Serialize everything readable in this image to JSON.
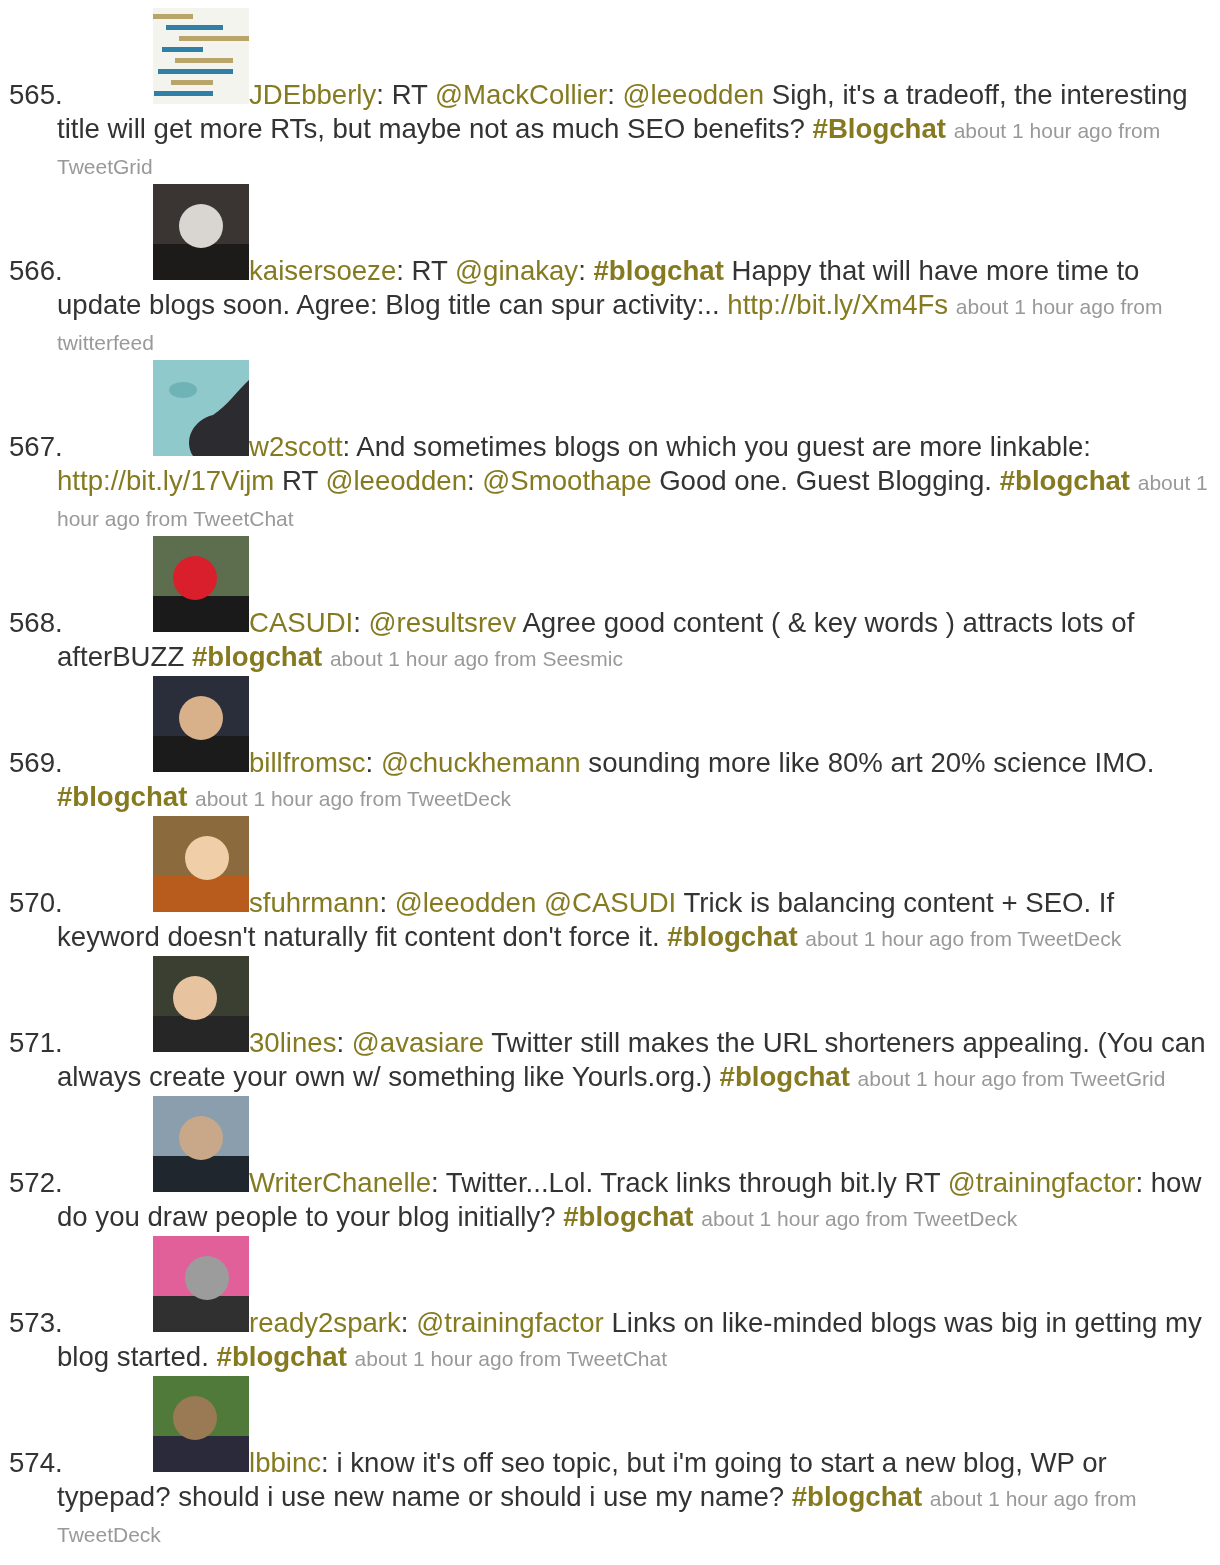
{
  "tweets": [
    {
      "number": "565.",
      "avatar": {
        "kind": "picture"
      },
      "parts": [
        {
          "kind": "user",
          "text": "JDEbberly"
        },
        {
          "kind": "text",
          "text": ": RT "
        },
        {
          "kind": "mention",
          "text": "@MackCollier"
        },
        {
          "kind": "text",
          "text": ": "
        },
        {
          "kind": "mention",
          "text": "@leeodden"
        },
        {
          "kind": "text",
          "text": " Sigh, it's a tradeoff, the interesting title will get more RTs, but maybe not as much SEO benefits? "
        },
        {
          "kind": "hashtag",
          "text": "#Blogchat"
        }
      ],
      "meta": "about 1 hour ago from TweetGrid"
    },
    {
      "number": "566.",
      "avatar": {
        "kind": "picture"
      },
      "parts": [
        {
          "kind": "user",
          "text": "kaisersoeze"
        },
        {
          "kind": "text",
          "text": ": RT "
        },
        {
          "kind": "mention",
          "text": "@ginakay"
        },
        {
          "kind": "text",
          "text": ": "
        },
        {
          "kind": "hashtag",
          "text": "#blogchat"
        },
        {
          "kind": "text",
          "text": " Happy that will have more time to update blogs soon. Agree: Blog title can spur activity:.. "
        },
        {
          "kind": "url",
          "text": "http://bit.ly/Xm4Fs"
        }
      ],
      "meta": "about 1 hour ago from twitterfeed"
    },
    {
      "number": "567.",
      "avatar": {
        "kind": "picture"
      },
      "parts": [
        {
          "kind": "user",
          "text": "w2scott"
        },
        {
          "kind": "text",
          "text": ": And sometimes blogs on which you guest are more linkable: "
        },
        {
          "kind": "url",
          "text": "http://bit.ly/17Vijm"
        },
        {
          "kind": "text",
          "text": " RT "
        },
        {
          "kind": "mention",
          "text": "@leeodden"
        },
        {
          "kind": "text",
          "text": ": "
        },
        {
          "kind": "mention",
          "text": "@Smoothape"
        },
        {
          "kind": "text",
          "text": " Good one. Guest Blogging. "
        },
        {
          "kind": "hashtag",
          "text": "#blogchat"
        }
      ],
      "meta": "about 1 hour ago from TweetChat"
    },
    {
      "number": "568.",
      "avatar": {
        "kind": "picture"
      },
      "parts": [
        {
          "kind": "user",
          "text": "CASUDI"
        },
        {
          "kind": "text",
          "text": ": "
        },
        {
          "kind": "mention",
          "text": "@resultsrev"
        },
        {
          "kind": "text",
          "text": " Agree good content ( & key words ) attracts lots of afterBUZZ "
        },
        {
          "kind": "hashtag",
          "text": "#blogchat"
        }
      ],
      "meta": "about 1 hour ago from Seesmic"
    },
    {
      "number": "569.",
      "avatar": {
        "kind": "picture"
      },
      "parts": [
        {
          "kind": "user",
          "text": "billfromsc"
        },
        {
          "kind": "text",
          "text": ": "
        },
        {
          "kind": "mention",
          "text": "@chuckhemann"
        },
        {
          "kind": "text",
          "text": " sounding more like 80% art 20% science IMO. "
        },
        {
          "kind": "hashtag",
          "text": "#blogchat"
        }
      ],
      "meta": "about 1 hour ago from TweetDeck"
    },
    {
      "number": "570.",
      "avatar": {
        "kind": "picture"
      },
      "parts": [
        {
          "kind": "user",
          "text": "sfuhrmann"
        },
        {
          "kind": "text",
          "text": ": "
        },
        {
          "kind": "mention",
          "text": "@leeodden"
        },
        {
          "kind": "mention",
          "text": "@CASUDI"
        },
        {
          "kind": "text",
          "text": " Trick is balancing content + SEO. If keyword doesn't naturally fit content don't force it. "
        },
        {
          "kind": "hashtag",
          "text": "#blogchat"
        }
      ],
      "meta": "about 1 hour ago from TweetDeck"
    },
    {
      "number": "571.",
      "avatar": {
        "kind": "picture"
      },
      "parts": [
        {
          "kind": "user",
          "text": "30lines"
        },
        {
          "kind": "text",
          "text": ": "
        },
        {
          "kind": "mention",
          "text": "@avasiare"
        },
        {
          "kind": "text",
          "text": " Twitter still makes the URL shorteners appealing. (You can always create your own w/ something like Yourls.org.) "
        },
        {
          "kind": "hashtag",
          "text": "#blogchat"
        }
      ],
      "meta": "about 1 hour ago from TweetGrid"
    },
    {
      "number": "572.",
      "avatar": {
        "kind": "picture"
      },
      "parts": [
        {
          "kind": "user",
          "text": "WriterChanelle"
        },
        {
          "kind": "text",
          "text": ": Twitter...Lol. Track links through bit.ly RT "
        },
        {
          "kind": "mention",
          "text": "@trainingfactor"
        },
        {
          "kind": "text",
          "text": ": how do you draw people to your blog initially? "
        },
        {
          "kind": "hashtag",
          "text": "#blogchat"
        }
      ],
      "meta": "about 1 hour ago from TweetDeck"
    },
    {
      "number": "573.",
      "avatar": {
        "kind": "picture"
      },
      "parts": [
        {
          "kind": "user",
          "text": "ready2spark"
        },
        {
          "kind": "text",
          "text": ": "
        },
        {
          "kind": "mention",
          "text": "@trainingfactor"
        },
        {
          "kind": "text",
          "text": " Links on like-minded blogs was big in getting my blog started. "
        },
        {
          "kind": "hashtag",
          "text": "#blogchat"
        }
      ],
      "meta": "about 1 hour ago from TweetChat"
    },
    {
      "number": "574.",
      "avatar": {
        "kind": "picture"
      },
      "parts": [
        {
          "kind": "user",
          "text": "lbbinc"
        },
        {
          "kind": "text",
          "text": ": i know it's off seo topic, but i'm going to start a new blog, WP or typepad? should i use new name or should i use my name? "
        },
        {
          "kind": "hashtag",
          "text": "#blogchat"
        }
      ],
      "meta": "about 1 hour ago from TweetDeck"
    }
  ]
}
